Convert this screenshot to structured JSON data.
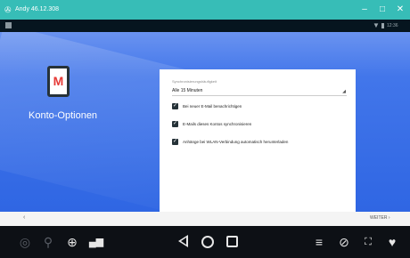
{
  "window": {
    "icon": "android-icon",
    "title": "Andy 46.12.308",
    "controls": {
      "minimize": "–",
      "maximize": "□",
      "close": "✕"
    }
  },
  "status_bar": {
    "time": "12:36",
    "icons": [
      "wifi-icon",
      "battery-icon"
    ]
  },
  "setup": {
    "heading": "Konto-Optionen",
    "sync_frequency": {
      "label": "Synchronisierungshäufigkeit",
      "value": "Alle 15 Minuten"
    },
    "options": [
      {
        "label": "Bei neuer E-Mail benachrichtigen",
        "checked": true
      },
      {
        "label": "E-Mails dieses Kontos synchronisieren",
        "checked": true
      },
      {
        "label": "Anhänge bei WLAN-Verbindung automatisch herunterladen",
        "checked": true
      }
    ],
    "back_glyph": "‹",
    "next_label": "WEITER"
  },
  "toolbar": {
    "left_icons": [
      "camera-icon",
      "microphone-icon",
      "gps-icon",
      "network-icon"
    ],
    "nav_icons": [
      "back-icon",
      "home-icon",
      "recent-apps-icon"
    ],
    "right_icons": [
      "menu-icon",
      "rotate-icon",
      "fullscreen-icon",
      "favorite-icon"
    ]
  },
  "colors": {
    "titlebar": "#37bdb7",
    "hero": "#2f66e3",
    "mail_red": "#e53935",
    "checkbox": "#263238"
  }
}
